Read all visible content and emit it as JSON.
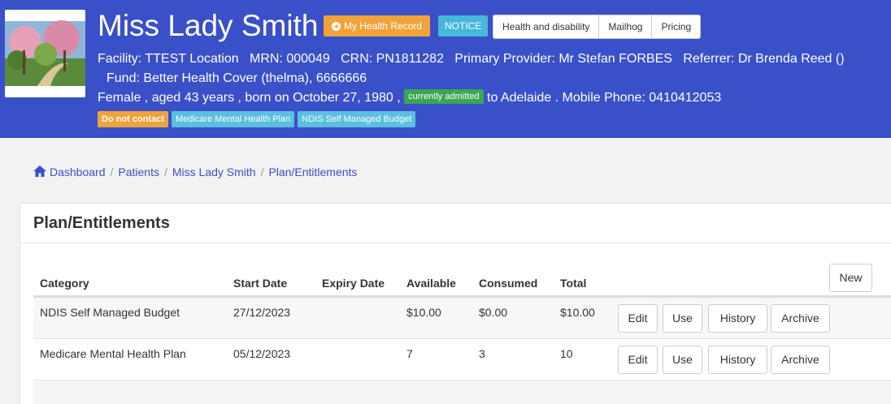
{
  "patient": {
    "name": "Miss Lady Smith",
    "my_health_record_label": "My Health Record",
    "notice_label": "NOTICE",
    "tabs": [
      "Health and disability",
      "Mailhog",
      "Pricing"
    ],
    "info_line1": "Facility: TTEST Location   MRN: 000049   CRN: PN1811282   Primary Provider: Mr Stefan FORBES   Referrer: Dr Brenda Reed ()",
    "info_line2": "Fund: Better Health Cover (thelma), 6666666",
    "info_line3_pre": "Female , aged 43 years , born on October 27, 1980 , ",
    "admitted_badge": "currently admitted",
    "info_line3_post": " to Adelaide . Mobile Phone: 0410412053",
    "tags": [
      "Do not contact",
      "Medicare Mental Health Plan",
      "NDIS Self Managed Budget"
    ]
  },
  "breadcrumb": [
    "Dashboard",
    "Patients",
    "Miss Lady Smith",
    "Plan/Entitlements"
  ],
  "panel": {
    "title": "Plan/Entitlements",
    "new_label": "New",
    "columns": [
      "Category",
      "Start Date",
      "Expiry Date",
      "Available",
      "Consumed",
      "Total"
    ],
    "rows": [
      {
        "category": "NDIS Self Managed Budget",
        "start": "27/12/2023",
        "expiry": "",
        "available": "$10.00",
        "consumed": "$0.00",
        "total": "$10.00"
      },
      {
        "category": "Medicare Mental Health Plan",
        "start": "05/12/2023",
        "expiry": "",
        "available": "7",
        "consumed": "3",
        "total": "10"
      }
    ],
    "actions": [
      "Edit",
      "Use",
      "History",
      "Archive"
    ]
  },
  "colors": {
    "header": "#3a50c8",
    "orange": "#f0a33a",
    "cyan": "#5bc0de",
    "green": "#3aa655"
  }
}
